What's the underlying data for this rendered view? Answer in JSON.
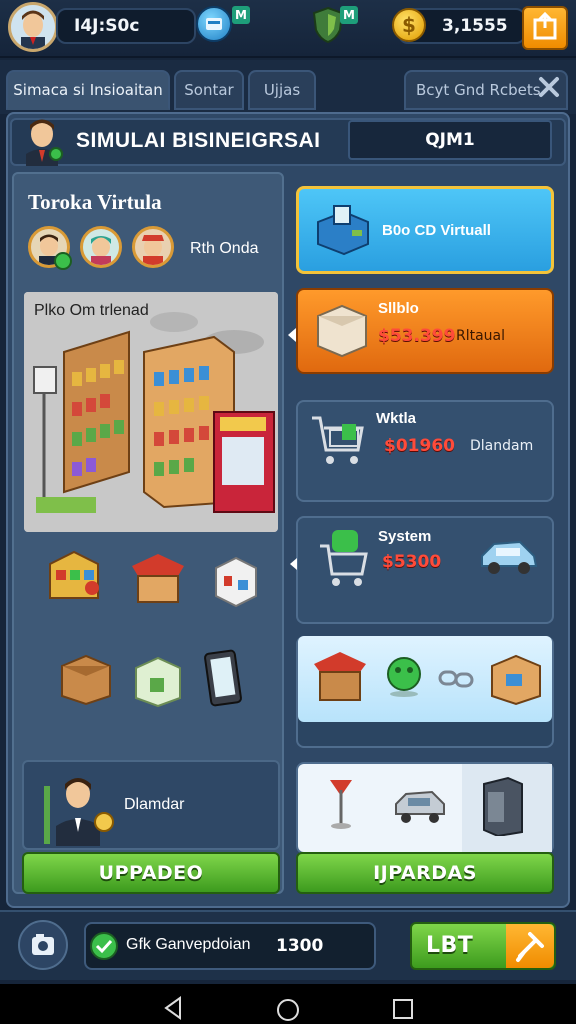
{
  "topbar": {
    "player_value": "I4J:S0c",
    "gem_badge": "M",
    "shield_badge": "M",
    "coins": "3,1555"
  },
  "tabs": [
    {
      "label": "Simaca si Insioaitan"
    },
    {
      "label": "Sontar"
    },
    {
      "label": "Ujjas"
    }
  ],
  "tab_right": {
    "label": "Bcyt Gnd Rcbets"
  },
  "header": {
    "title": "SIMULAI BISINEIGRSAI",
    "code": "QJM1"
  },
  "left": {
    "store_title": "Toroka Virtula",
    "team_label": "Rth Onda",
    "store_label": "Plko Om trlenad",
    "manager_label": "Dlamdar",
    "upgrade_button": "UPPADEO"
  },
  "right": {
    "card1": {
      "label": "B0o CD Virtuall"
    },
    "card2": {
      "title": "Sllblo",
      "value": "$53.399",
      "desc": "Rltaual"
    },
    "card3": {
      "title": "Wktla",
      "value": "$01960",
      "desc": "Dlandam"
    },
    "card4": {
      "title": "System",
      "value": "$5300"
    },
    "upgrade_button": "IJPARDAS"
  },
  "bottom": {
    "status_text": "Gfk Ganvepdoian",
    "status_value": "1300",
    "action_button": "LBT"
  },
  "colors": {
    "accent_green": "#5cc030",
    "accent_orange": "#f2911a",
    "accent_blue": "#36b8f2",
    "value_red": "#ff4b3a"
  }
}
